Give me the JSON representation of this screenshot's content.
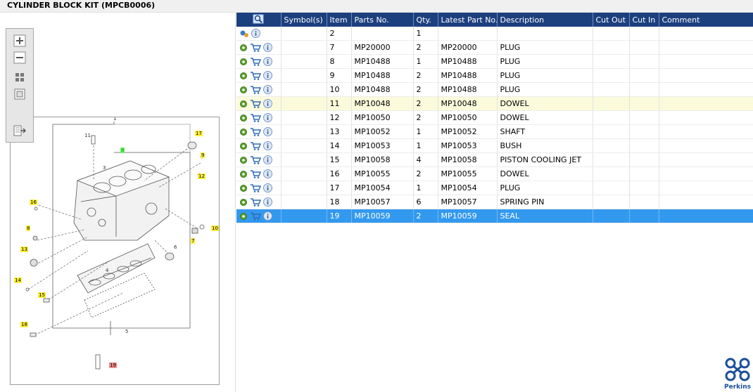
{
  "window": {
    "title": "CYLINDER BLOCK KIT (MPCB0006)"
  },
  "toolbar": {
    "zoom_in": "zoom-in-icon",
    "zoom_out": "zoom-out-icon",
    "fit_all": "fit-all-icon",
    "fit_width": "fit-page-icon",
    "export": "export-icon"
  },
  "drawing": {
    "callouts": [
      "1",
      "11",
      "8",
      "3",
      "17",
      "9",
      "12",
      "10",
      "16",
      "8",
      "7",
      "6",
      "13",
      "4",
      "14",
      "15",
      "18",
      "5",
      "19"
    ]
  },
  "table": {
    "headers": [
      "",
      "Symbol(s)",
      "Item",
      "Parts No.",
      "Qty.",
      "Latest Part No.",
      "Description",
      "Cut Out",
      "Cut In",
      "Comment"
    ],
    "rows": [
      {
        "item": "2",
        "part": "",
        "qty": "1",
        "latest": "",
        "desc": "",
        "cart": false,
        "state": ""
      },
      {
        "item": "7",
        "part": "MP20000",
        "qty": "2",
        "latest": "MP20000",
        "desc": "PLUG",
        "cart": true,
        "state": ""
      },
      {
        "item": "8",
        "part": "MP10488",
        "qty": "1",
        "latest": "MP10488",
        "desc": "PLUG",
        "cart": true,
        "state": ""
      },
      {
        "item": "9",
        "part": "MP10488",
        "qty": "2",
        "latest": "MP10488",
        "desc": "PLUG",
        "cart": true,
        "state": ""
      },
      {
        "item": "10",
        "part": "MP10488",
        "qty": "2",
        "latest": "MP10488",
        "desc": "PLUG",
        "cart": true,
        "state": ""
      },
      {
        "item": "11",
        "part": "MP10048",
        "qty": "2",
        "latest": "MP10048",
        "desc": "DOWEL",
        "cart": true,
        "state": "hl"
      },
      {
        "item": "12",
        "part": "MP10050",
        "qty": "2",
        "latest": "MP10050",
        "desc": "DOWEL",
        "cart": true,
        "state": ""
      },
      {
        "item": "13",
        "part": "MP10052",
        "qty": "1",
        "latest": "MP10052",
        "desc": "SHAFT",
        "cart": true,
        "state": ""
      },
      {
        "item": "14",
        "part": "MP10053",
        "qty": "1",
        "latest": "MP10053",
        "desc": "BUSH",
        "cart": true,
        "state": ""
      },
      {
        "item": "15",
        "part": "MP10058",
        "qty": "4",
        "latest": "MP10058",
        "desc": "PISTON COOLING JET",
        "cart": true,
        "state": ""
      },
      {
        "item": "16",
        "part": "MP10055",
        "qty": "2",
        "latest": "MP10055",
        "desc": "DOWEL",
        "cart": true,
        "state": ""
      },
      {
        "item": "17",
        "part": "MP10054",
        "qty": "1",
        "latest": "MP10054",
        "desc": "PLUG",
        "cart": true,
        "state": ""
      },
      {
        "item": "18",
        "part": "MP10057",
        "qty": "6",
        "latest": "MP10057",
        "desc": "SPRING PIN",
        "cart": true,
        "state": ""
      },
      {
        "item": "19",
        "part": "MP10059",
        "qty": "2",
        "latest": "MP10059",
        "desc": "SEAL",
        "cart": true,
        "state": "sel"
      }
    ]
  },
  "brand": {
    "name": "Perkins",
    "color": "#1a4f9c"
  },
  "colors": {
    "header_bg": "#1c3f7e",
    "selected_row": "#3399ef",
    "highlight_row": "#fbfbdc"
  }
}
